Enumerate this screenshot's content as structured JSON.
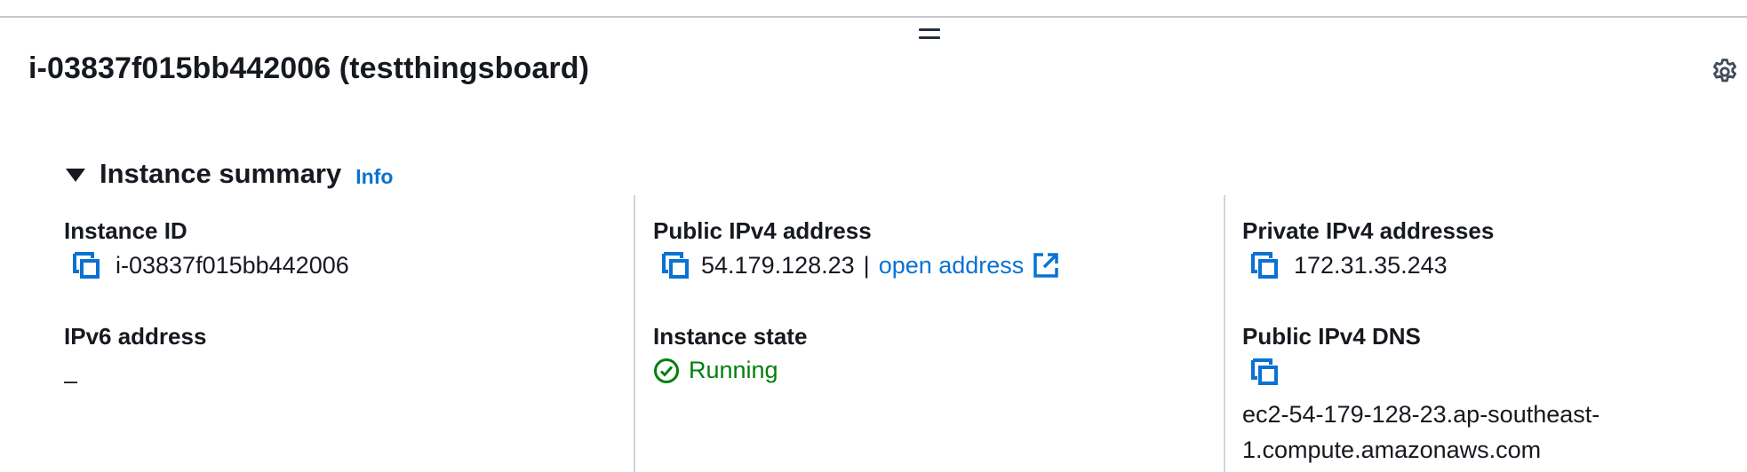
{
  "header": {
    "title": "i-03837f015bb442006 (testthingsboard)"
  },
  "section": {
    "title": "Instance summary",
    "info_label": "Info"
  },
  "fields": {
    "instance_id": {
      "label": "Instance ID",
      "value": "i-03837f015bb442006"
    },
    "public_ipv4": {
      "label": "Public IPv4 address",
      "value": "54.179.128.23",
      "separator": "|",
      "link_label": "open address"
    },
    "private_ipv4": {
      "label": "Private IPv4 addresses",
      "value": "172.31.35.243"
    },
    "ipv6": {
      "label": "IPv6 address",
      "value": "–"
    },
    "instance_state": {
      "label": "Instance state",
      "value": "Running"
    },
    "public_dns": {
      "label": "Public IPv4 DNS",
      "value": "ec2-54-179-128-23.ap-southeast-1.compute.amazonaws.com"
    }
  },
  "colors": {
    "link": "#0972d3",
    "success": "#037f0c",
    "text": "#16191f"
  },
  "icons": [
    "drag-handle-icon",
    "gear-icon",
    "caret-down-icon",
    "copy-icon",
    "external-link-icon",
    "check-circle-icon"
  ]
}
